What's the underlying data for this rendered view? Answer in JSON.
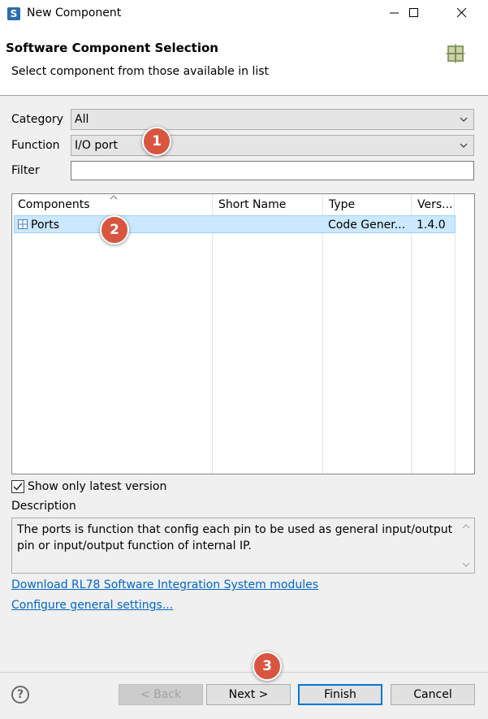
{
  "window": {
    "title": "New Component"
  },
  "header": {
    "title": "Software Component Selection",
    "subtitle": "Select component from those available in list"
  },
  "form": {
    "category_label": "Category",
    "category_value": "All",
    "function_label": "Function",
    "function_value": "I/O port",
    "filter_label": "Filter",
    "filter_value": ""
  },
  "table": {
    "headers": [
      "Components",
      "Short Name",
      "Type",
      "Vers..."
    ],
    "rows": [
      {
        "component": "Ports",
        "short_name": "",
        "type": "Code Gener...",
        "version": "1.4.0"
      }
    ]
  },
  "options": {
    "show_latest_label": "Show only latest version",
    "show_latest_checked": true
  },
  "description": {
    "label": "Description",
    "text": "The ports is function that config each pin to be used as general input/output pin or input/output function of internal IP."
  },
  "links": {
    "download": "Download RL78 Software Integration System modules",
    "configure": "Configure general settings..."
  },
  "buttons": {
    "back": "< Back",
    "next": "Next >",
    "finish": "Finish",
    "cancel": "Cancel"
  },
  "callouts": [
    "1",
    "2",
    "3"
  ],
  "colors": {
    "callout": "#d9553f",
    "selection": "#cce8ff",
    "link": "#0066cc",
    "default_button_border": "#0078d7"
  }
}
